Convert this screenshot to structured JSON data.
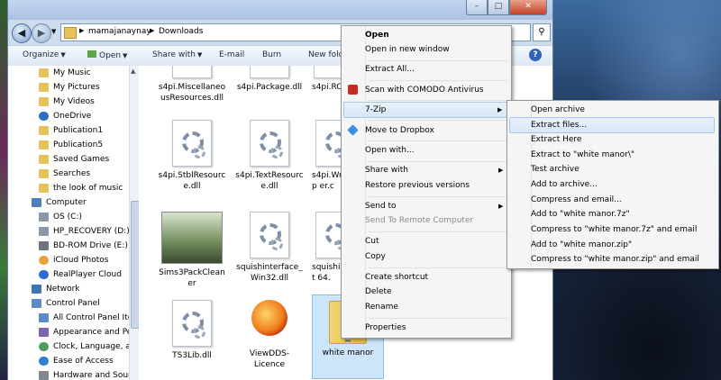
{
  "window": {
    "address_segments": [
      "mamajanaynay",
      "Downloads"
    ],
    "controls": {
      "minimize": "–",
      "maximize": "□",
      "close": "✕"
    }
  },
  "toolbar": {
    "organize": "Organize",
    "open": "Open",
    "share_with": "Share with",
    "email": "E-mail",
    "burn": "Burn",
    "new_folder": "New folder",
    "help": "?"
  },
  "nav_pane": {
    "items": [
      {
        "label": "My Music",
        "icon": "music-folder-icon"
      },
      {
        "label": "My Pictures",
        "icon": "pictures-folder-icon"
      },
      {
        "label": "My Videos",
        "icon": "videos-folder-icon"
      },
      {
        "label": "OneDrive",
        "icon": "onedrive-icon"
      },
      {
        "label": "Publication1",
        "icon": "folder-icon"
      },
      {
        "label": "Publication5",
        "icon": "folder-icon"
      },
      {
        "label": "Saved Games",
        "icon": "folder-icon"
      },
      {
        "label": "Searches",
        "icon": "search-folder-icon"
      },
      {
        "label": "the look of music",
        "icon": "folder-icon"
      },
      {
        "label": "Computer",
        "icon": "computer-icon"
      },
      {
        "label": "OS (C:)",
        "icon": "drive-icon"
      },
      {
        "label": "HP_RECOVERY (D:)",
        "icon": "drive-icon"
      },
      {
        "label": "BD-ROM Drive (E:)",
        "icon": "disc-drive-icon"
      },
      {
        "label": "iCloud Photos",
        "icon": "icloud-icon"
      },
      {
        "label": "RealPlayer Cloud",
        "icon": "realplayer-icon"
      },
      {
        "label": "Network",
        "icon": "network-icon"
      },
      {
        "label": "Control Panel",
        "icon": "control-panel-icon"
      },
      {
        "label": "All Control Panel Iter",
        "icon": "control-panel-icon"
      },
      {
        "label": "Appearance and Pers",
        "icon": "appearance-icon"
      },
      {
        "label": "Clock, Language, an",
        "icon": "clock-icon"
      },
      {
        "label": "Ease of Access",
        "icon": "ease-of-access-icon"
      },
      {
        "label": "Hardware and Sound",
        "icon": "hardware-icon"
      }
    ]
  },
  "files": [
    {
      "name": "s4pi.MiscellaneousResources.dll",
      "icon": "dll-icon"
    },
    {
      "name": "s4pi.Package.dll",
      "icon": "dll-icon"
    },
    {
      "name": "s4pi.RC",
      "icon": "dll-icon"
    },
    {
      "name": "s4pi.StblResource.dll",
      "icon": "dll-icon"
    },
    {
      "name": "s4pi.TextResource.dll",
      "icon": "dll-icon"
    },
    {
      "name": "s4pi.Wrap er.c",
      "icon": "dll-icon"
    },
    {
      "name": "Sims3PackCleaner",
      "icon": "app-thumbnail-icon"
    },
    {
      "name": "squishinterface_Win32.dll",
      "icon": "dll-icon"
    },
    {
      "name": "squishint 64.",
      "icon": "dll-icon"
    },
    {
      "name": "TS3Lib.dll",
      "icon": "dll-icon"
    },
    {
      "name": "ViewDDS-Licence",
      "icon": "firefox-icon"
    },
    {
      "name": "white manor",
      "icon": "zip-folder-icon"
    }
  ],
  "context_menu": {
    "items": [
      "Open",
      "Open in new window",
      "Extract All...",
      "Scan with COMODO Antivirus",
      "7-Zip",
      "Move to Dropbox",
      "Open with...",
      "Share with",
      "Restore previous versions",
      "Send to",
      "Send To Remote Computer",
      "Cut",
      "Copy",
      "Create shortcut",
      "Delete",
      "Rename",
      "Properties"
    ],
    "submenu_arrow": "▶"
  },
  "sevenzip_menu": {
    "items": [
      "Open archive",
      "Extract files...",
      "Extract Here",
      "Extract to \"white manor\\\"",
      "Test archive",
      "Add to archive...",
      "Compress and email...",
      "Add to \"white manor.7z\"",
      "Compress to \"white manor.7z\" and email",
      "Add to \"white manor.zip\"",
      "Compress to \"white manor.zip\" and email"
    ]
  }
}
